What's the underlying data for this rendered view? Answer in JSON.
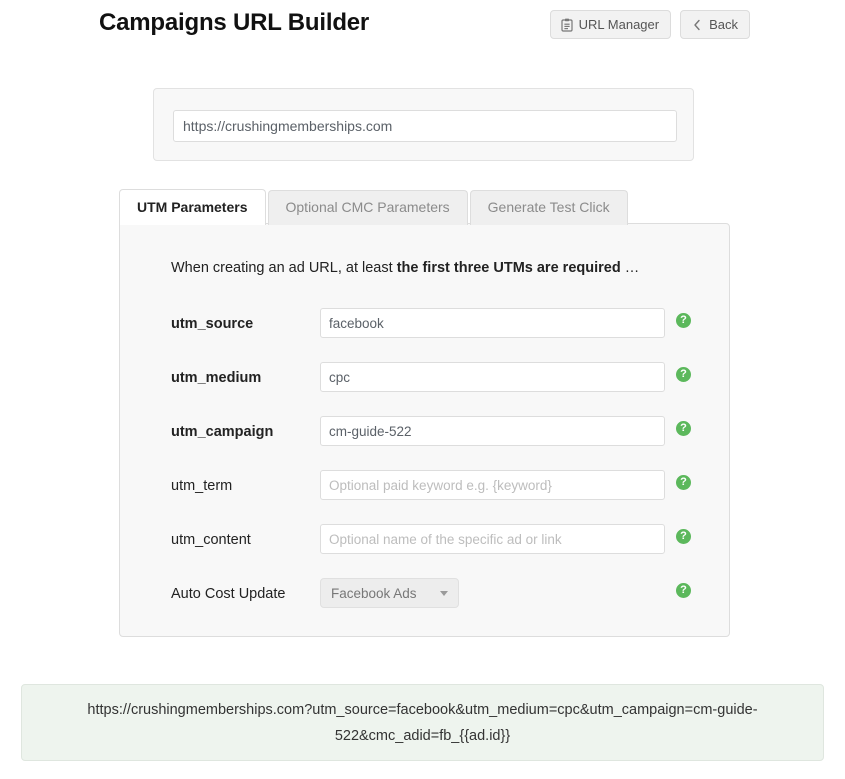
{
  "header": {
    "title": "Campaigns URL Builder",
    "buttons": [
      {
        "label": "URL Manager",
        "icon": "clipboard-icon"
      },
      {
        "label": "Back",
        "icon": "chevron-left-icon"
      }
    ]
  },
  "url_card": {
    "value": "https://crushingmemberships.com",
    "placeholder": "https://"
  },
  "tabs": [
    {
      "label": "UTM Parameters",
      "active": true
    },
    {
      "label": "Optional CMC Parameters",
      "active": false
    },
    {
      "label": "Generate Test Click",
      "active": false
    }
  ],
  "panel": {
    "intro_prefix": "When creating an ad URL, at least ",
    "intro_bold": "the first three UTMs are required",
    "intro_suffix": " …",
    "rows": [
      {
        "label": "utm_source",
        "required": true,
        "type": "text",
        "value": "facebook",
        "placeholder": "",
        "help": "?"
      },
      {
        "label": "utm_medium",
        "required": true,
        "type": "text",
        "value": "cpc",
        "placeholder": "",
        "help": "?"
      },
      {
        "label": "utm_campaign",
        "required": true,
        "type": "text",
        "value": "cm-guide-522",
        "placeholder": "",
        "help": "?"
      },
      {
        "label": "utm_term",
        "required": false,
        "type": "text",
        "value": "",
        "placeholder": "Optional paid keyword e.g. {keyword}",
        "help": "?"
      },
      {
        "label": "utm_content",
        "required": false,
        "type": "text",
        "value": "",
        "placeholder": "Optional name of the specific ad or link",
        "help": "?"
      },
      {
        "label": "Auto Cost Update",
        "required": false,
        "type": "select",
        "value": "Facebook Ads",
        "placeholder": "",
        "help": "?"
      }
    ]
  },
  "result": {
    "url": "https://crushingmemberships.com?utm_source=facebook&utm_medium=cpc&utm_campaign=cm-guide-522&cmc_adid=fb_{{ad.id}}"
  },
  "colors": {
    "help_green": "#5cb85c",
    "result_bg": "#eef4ee",
    "panel_bg": "#f8f8f8"
  }
}
